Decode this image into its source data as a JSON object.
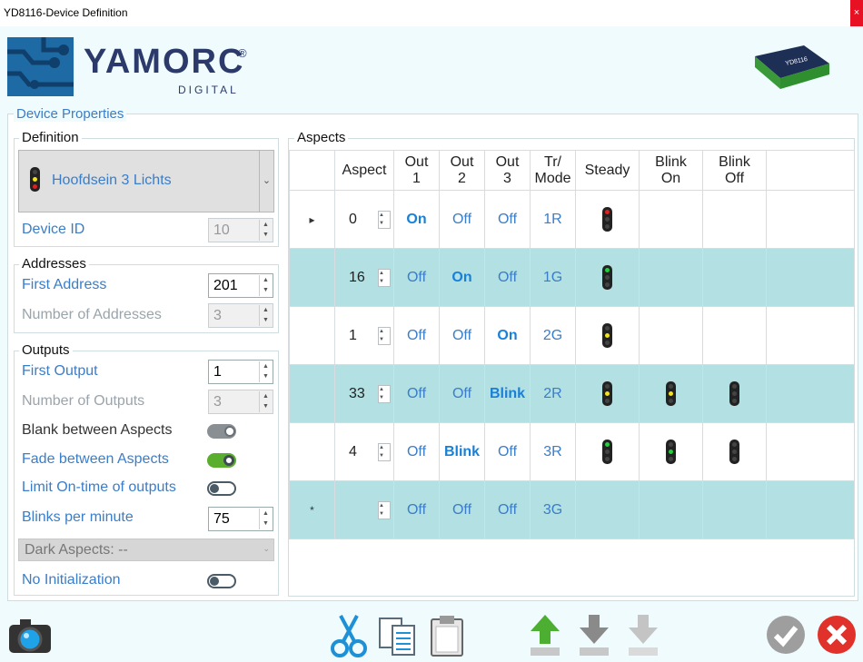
{
  "window": {
    "title": "YD8116-Device  Definition",
    "close": "×"
  },
  "brand": {
    "name": "YAMORC",
    "reg": "®",
    "sub": "DIGITAL"
  },
  "device_properties": {
    "label": "Device Properties",
    "definition": {
      "label": "Definition",
      "selected": "Hoofdsein 3 Lichts",
      "device_id_label": "Device ID",
      "device_id_value": "10"
    },
    "addresses": {
      "label": "Addresses",
      "first_address_label": "First Address",
      "first_address_value": "201",
      "num_addresses_label": "Number of Addresses",
      "num_addresses_value": "3"
    },
    "outputs": {
      "label": "Outputs",
      "first_output_label": "First Output",
      "first_output_value": "1",
      "num_outputs_label": "Number of Outputs",
      "num_outputs_value": "3",
      "blank_label": "Blank between Aspects",
      "fade_label": "Fade between Aspects",
      "limit_label": "Limit On-time of outputs",
      "blinks_label": "Blinks per minute",
      "blinks_value": "75",
      "dark_aspects": "Dark Aspects: --",
      "no_init_label": "No Initialization"
    }
  },
  "aspects": {
    "label": "Aspects",
    "columns": [
      "Aspect",
      "Out\n1",
      "Out\n2",
      "Out\n3",
      "Tr/\nMode",
      "Steady",
      "Blink\nOn",
      "Blink\nOff"
    ],
    "col_lines": [
      [
        "Aspect",
        ""
      ],
      [
        "Out",
        "1"
      ],
      [
        "Out",
        "2"
      ],
      [
        "Out",
        "3"
      ],
      [
        "Tr/",
        "Mode"
      ],
      [
        "Steady",
        ""
      ],
      [
        "Blink",
        "On"
      ],
      [
        "Blink",
        "Off"
      ]
    ],
    "rows": [
      {
        "marker": "▸",
        "aspect": "0",
        "out1": "On",
        "out2": "Off",
        "out3": "Off",
        "mode": "1R"
      },
      {
        "marker": "",
        "aspect": "16",
        "out1": "Off",
        "out2": "On",
        "out3": "Off",
        "mode": "1G"
      },
      {
        "marker": "",
        "aspect": "1",
        "out1": "Off",
        "out2": "Off",
        "out3": "On",
        "mode": "2G"
      },
      {
        "marker": "",
        "aspect": "33",
        "out1": "Off",
        "out2": "Off",
        "out3": "Blink",
        "mode": "2R"
      },
      {
        "marker": "",
        "aspect": "4",
        "out1": "Off",
        "out2": "Blink",
        "out3": "Off",
        "mode": "3R"
      },
      {
        "marker": "*",
        "aspect": "",
        "out1": "Off",
        "out2": "Off",
        "out3": "Off",
        "mode": "3G"
      }
    ]
  },
  "colors": {
    "accent": "#3a7dc8",
    "row_alt": "#b2e0e3",
    "signal_red": "#e02020",
    "signal_green": "#1fd13a",
    "signal_yellow": "#f2e21a"
  }
}
